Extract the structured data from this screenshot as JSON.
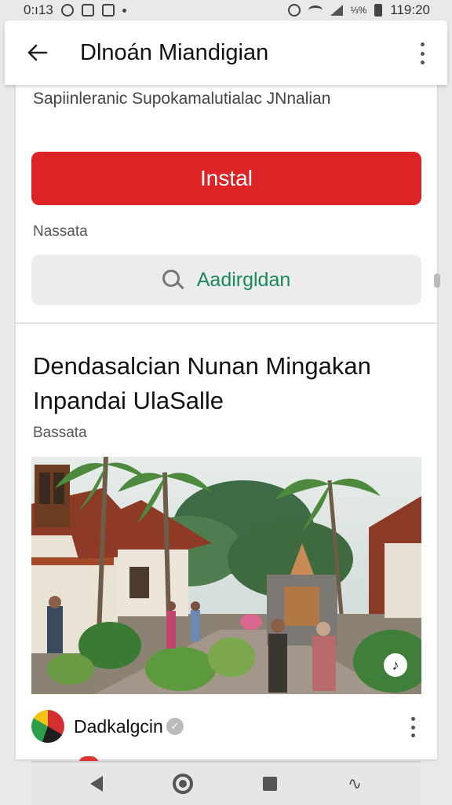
{
  "status_bar": {
    "left_text": "0:ı13",
    "time": "119:20",
    "battery_text": "⅓%"
  },
  "app_bar": {
    "title": "Dlnoán Miandigian",
    "back_icon": "arrow-left-icon",
    "menu_icon": "more-vertical-icon"
  },
  "card": {
    "subtitle": "Sapiinleranic Supokamalutialac JNnalian",
    "install_label": "Instal",
    "small_label": "Nassata",
    "search": {
      "text": "Aadirgldan",
      "icon": "search-icon"
    },
    "post": {
      "title": "Dendasalcian Nunan Mingakan Inpandai UlaSalle",
      "meta": "Bassata"
    },
    "photo": {
      "badge_icon": "tiktok-icon"
    },
    "source": {
      "name": "Dadkalgcin",
      "logo_icon": "source-logo-icon",
      "verified_icon": "verified-icon"
    }
  },
  "colors": {
    "install_button": "#dc2426",
    "search_text": "#1a8a5a",
    "background": "#e9e9e9"
  },
  "nav_bar": {
    "icons": [
      "back-triangle-icon",
      "home-circle-icon",
      "recent-square-icon",
      "assistant-icon"
    ]
  }
}
